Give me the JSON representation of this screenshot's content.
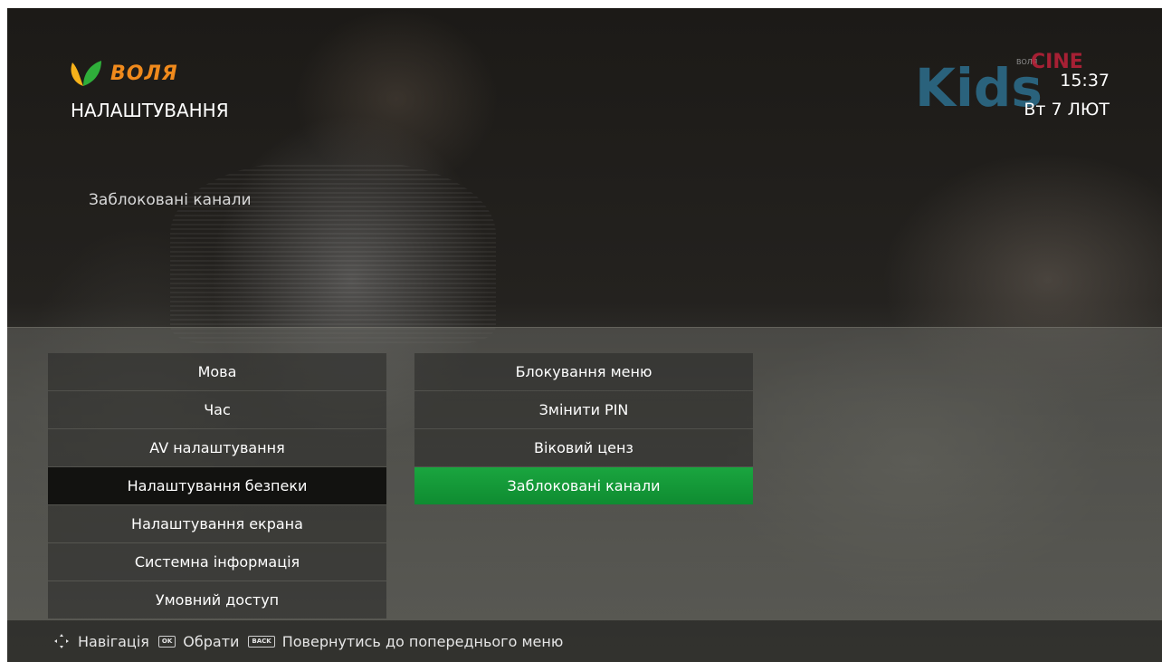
{
  "header": {
    "brand": "ВОЛЯ",
    "title": "НАЛАШТУВАННЯ",
    "subtitle": "Заблоковані канали",
    "time": "15:37",
    "date": "Вт 7 ЛЮТ",
    "channel_logo": {
      "main": "Kids",
      "tag_small": "ВОЛЯ",
      "tag": "CINE"
    }
  },
  "left_menu": {
    "items": [
      {
        "label": "Мова"
      },
      {
        "label": "Час"
      },
      {
        "label": "AV налаштування"
      },
      {
        "label": "Налаштування безпеки"
      },
      {
        "label": "Налаштування екрана"
      },
      {
        "label": "Системна інформація"
      },
      {
        "label": "Умовний доступ"
      }
    ],
    "selected_index": 3
  },
  "right_menu": {
    "items": [
      {
        "label": "Блокування меню"
      },
      {
        "label": "Змінити PIN"
      },
      {
        "label": "Віковий ценз"
      },
      {
        "label": "Заблоковані канали"
      }
    ],
    "active_index": 3
  },
  "footer": {
    "nav_label": "Навігація",
    "ok_key": "OK",
    "ok_label": "Обрати",
    "back_key": "BACK",
    "back_label": "Повернутись до попереднього меню"
  },
  "colors": {
    "brand_orange": "#f08a1c",
    "active_green": "#129a37"
  }
}
